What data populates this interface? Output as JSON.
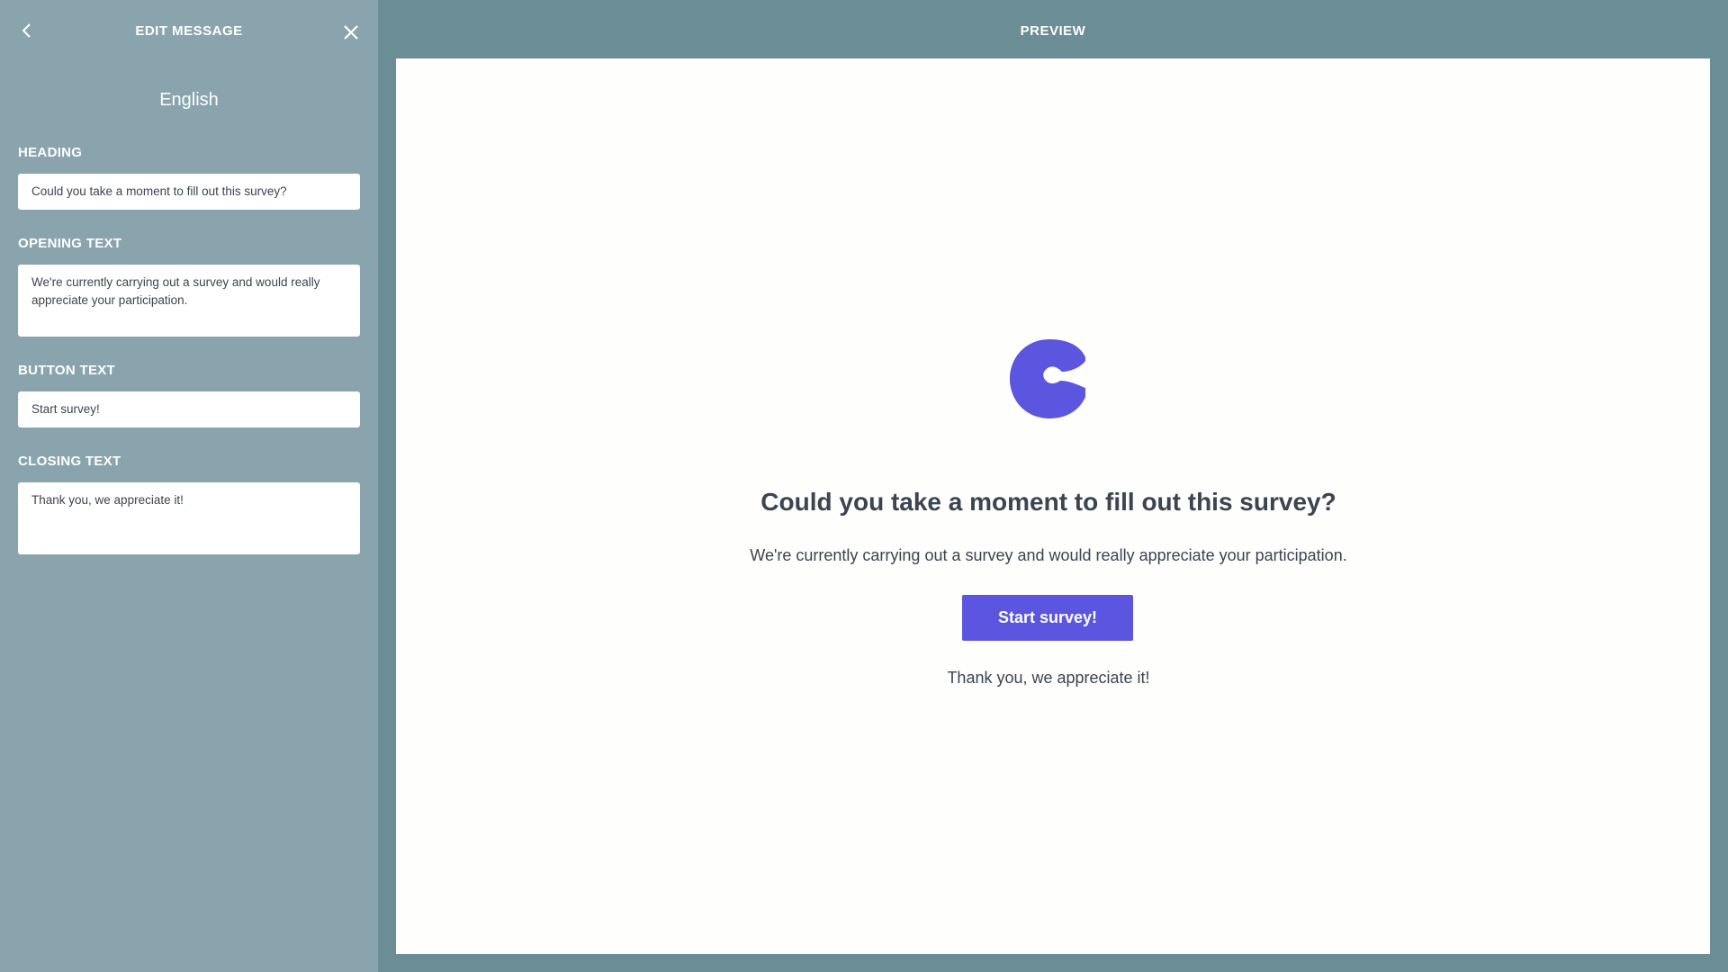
{
  "editor": {
    "title": "EDIT MESSAGE",
    "back_icon": "chevron-left-icon",
    "close_icon": "close-icon",
    "language": "English",
    "fields": {
      "heading": {
        "label": "HEADING",
        "value": "Could you take a moment to fill out this survey?"
      },
      "opening_text": {
        "label": "OPENING TEXT",
        "value": "We're currently carrying out a survey and would really appreciate your participation."
      },
      "button_text": {
        "label": "BUTTON TEXT",
        "value": "Start survey!"
      },
      "closing_text": {
        "label": "CLOSING TEXT",
        "value": "Thank you, we appreciate it!"
      }
    }
  },
  "preview": {
    "title": "PREVIEW",
    "logo_icon": "brand-logo-c",
    "heading": "Could you take a moment to fill out this survey?",
    "opening_text": "We're currently carrying out a survey and would really appreciate your participation.",
    "button_label": "Start survey!",
    "closing_text": "Thank you, we appreciate it!"
  },
  "colors": {
    "panel_bg": "#8aa4ad",
    "page_bg": "#6b8d95",
    "accent": "#5b55df",
    "text": "#3b4450"
  }
}
